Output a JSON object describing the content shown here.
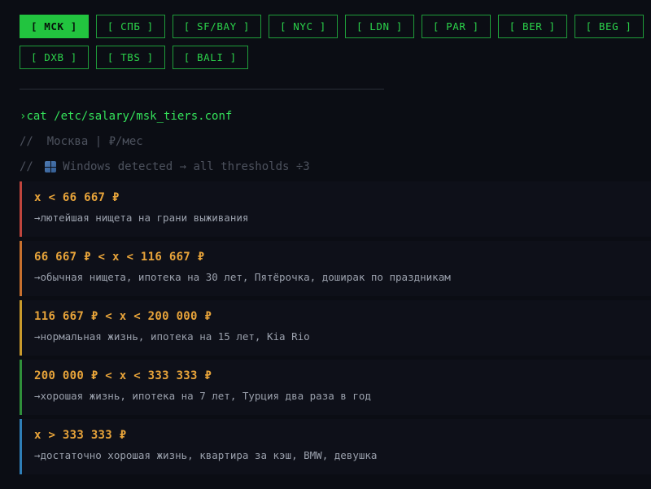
{
  "cities": {
    "row1": [
      {
        "label": "[ MCK ]",
        "active": true
      },
      {
        "label": "[ СПБ ]",
        "active": false
      },
      {
        "label": "[ SF/BAY ]",
        "active": false
      },
      {
        "label": "[ NYC ]",
        "active": false
      },
      {
        "label": "[ LDN ]",
        "active": false
      },
      {
        "label": "[ PAR ]",
        "active": false
      },
      {
        "label": "[ BER ]",
        "active": false
      },
      {
        "label": "[ BEG ]",
        "active": false
      }
    ],
    "row2": [
      {
        "label": "[ DXB ]",
        "active": false
      },
      {
        "label": "[ TBS ]",
        "active": false
      },
      {
        "label": "[ BALI ]",
        "active": false
      }
    ]
  },
  "terminal": {
    "prompt": "›",
    "command": "cat /etc/salary/msk_tiers.conf",
    "comment_city": "//  Москва | ₽/мес",
    "comment_windows_prefix": "// ",
    "comment_windows_icon": "windows-icon",
    "comment_windows_text": "Windows detected → all thresholds ÷3"
  },
  "tiers": [
    {
      "threshold": "x < 66 667 ₽",
      "desc": "→лютейшая нищета на грани выживания",
      "color": "#c0453d"
    },
    {
      "threshold": "66 667 ₽ < x < 116 667 ₽",
      "desc": "→обычная нищета, ипотека на 30 лет, Пятёрочка, доширак по праздникам",
      "color": "#c7702e"
    },
    {
      "threshold": "116 667 ₽ < x < 200 000 ₽",
      "desc": "→нормальная жизнь, ипотека на 15 лет, Kia Rio",
      "color": "#c99a2c"
    },
    {
      "threshold": "200 000 ₽ < x < 333 333 ₽",
      "desc": "→хорошая жизнь, ипотека на 7 лет, Турция два раза в год",
      "color": "#2f8f3a"
    },
    {
      "threshold": "x > 333 333 ₽",
      "desc": "→достаточно хорошая жизнь, квартира за кэш, BMW, девушка",
      "color": "#2f7fb8"
    }
  ],
  "colors": {
    "accent_green": "#22c43f",
    "threshold_text": "#e8a43a",
    "background": "#0b0d14"
  }
}
